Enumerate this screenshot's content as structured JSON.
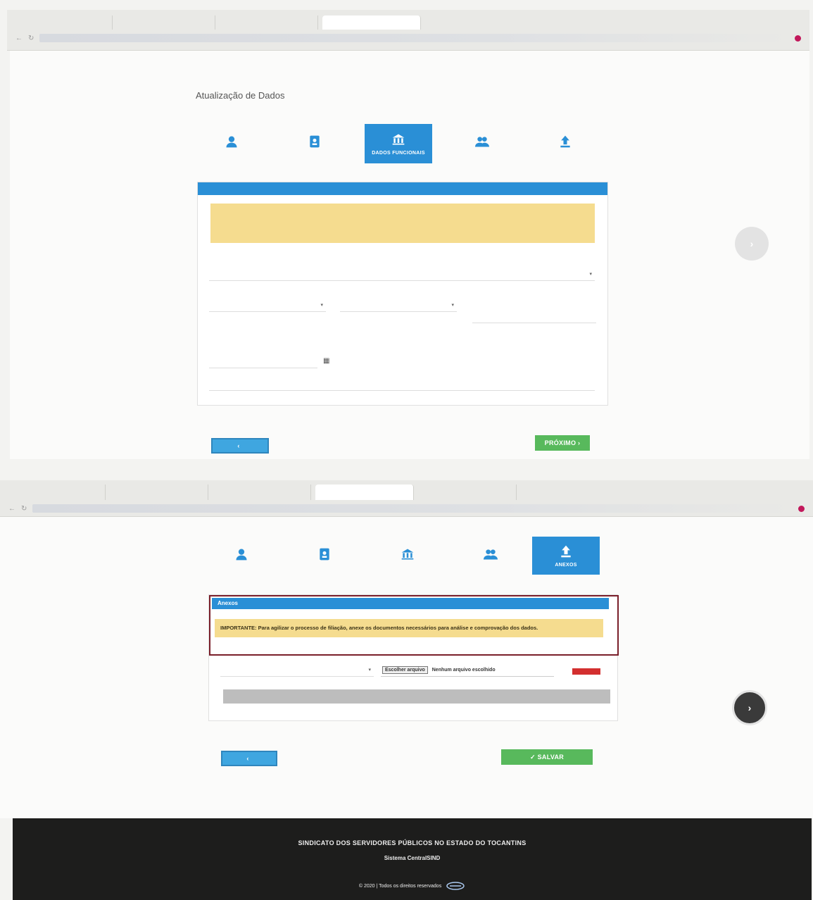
{
  "top_browser": {
    "tabs": [
      "",
      "",
      "",
      ""
    ]
  },
  "top_page": {
    "title": "Atualização de Dados",
    "steps": [
      {
        "icon": "person-icon",
        "label": ""
      },
      {
        "icon": "id-badge-icon",
        "label": ""
      },
      {
        "icon": "bank-icon",
        "label": "DADOS FUNCIONAIS"
      },
      {
        "icon": "group-icon",
        "label": ""
      },
      {
        "icon": "upload-icon",
        "label": ""
      }
    ],
    "card": {
      "header": "",
      "warning_lines": [
        "",
        ""
      ]
    },
    "back_label": "",
    "next_label": "PRÓXIMO"
  },
  "bottom_page": {
    "steps": [
      {
        "icon": "person-icon",
        "label": ""
      },
      {
        "icon": "id-badge-icon",
        "label": ""
      },
      {
        "icon": "bank-icon",
        "label": ""
      },
      {
        "icon": "group-icon",
        "label": ""
      },
      {
        "icon": "upload-icon",
        "label": "ANEXOS"
      }
    ],
    "card": {
      "header": "Anexos",
      "warning": "IMPORTANTE: Para agilizar o processo de filiação, anexe os documentos necessários para análise e comprovação dos dados."
    },
    "choose_file_label": "Escolher arquivo",
    "no_file_label": "Nenhum arquivo escolhido",
    "remove_label": "",
    "add_label": "",
    "back_label": "",
    "save_label": "SALVAR"
  },
  "footer": {
    "line1": "SINDICATO DOS SERVIDORES PÚBLICOS NO ESTADO DO TOCANTINS",
    "line2": "Sistema CentralSIND",
    "line3": "© 2020 | Todos os direitos reservados"
  },
  "colors": {
    "primary": "#2a8fd6",
    "warning_bg": "#f5dc8f",
    "success": "#58b95c",
    "danger": "#d32f2f",
    "footer_bg": "#1d1d1c"
  }
}
